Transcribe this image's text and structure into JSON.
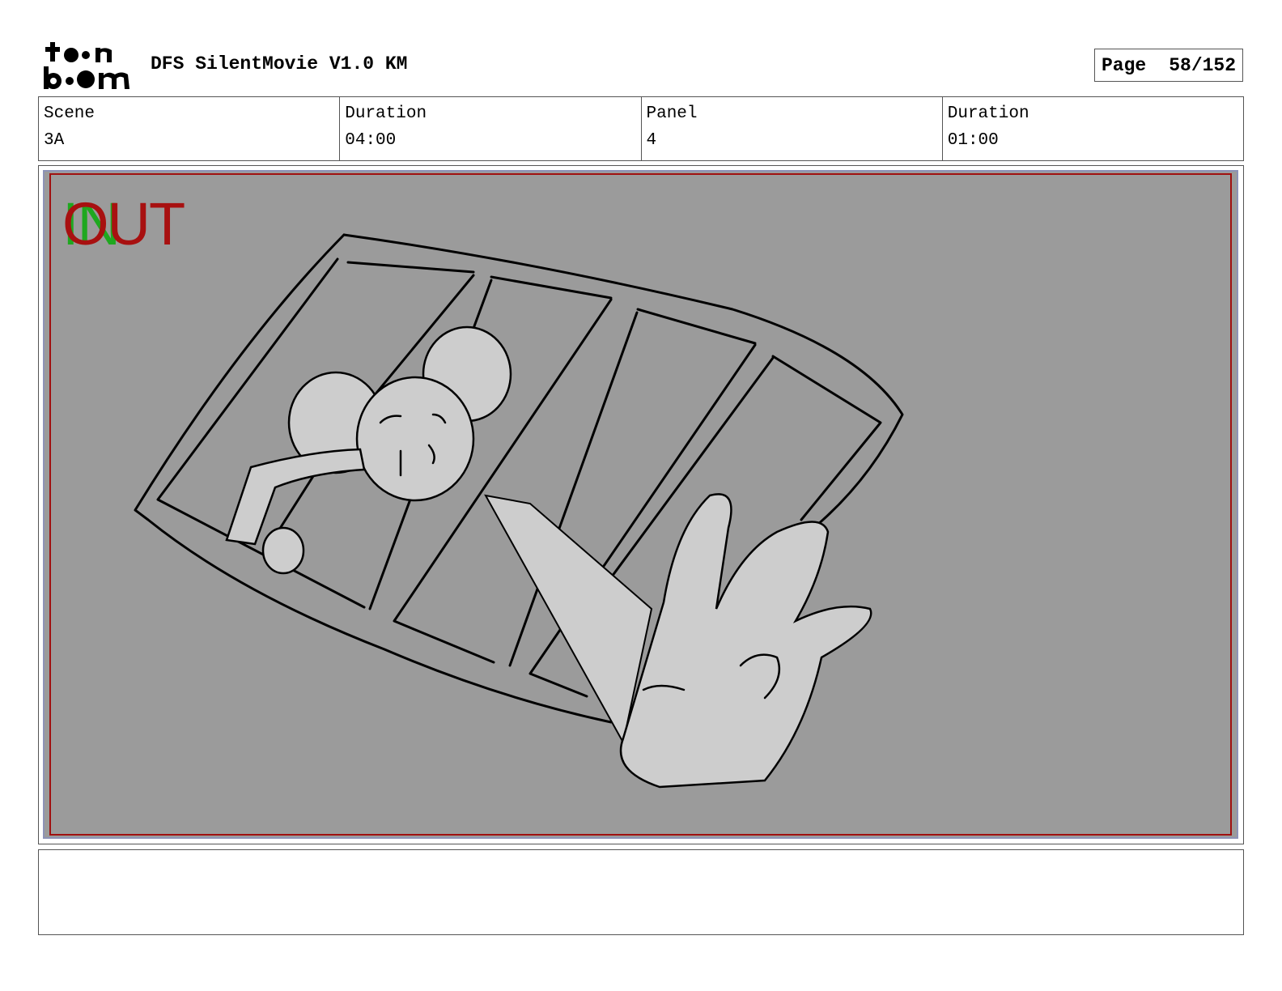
{
  "header": {
    "logo_text": "toon boom",
    "title": "DFS SilentMovie V1.0 KM",
    "page_label": "Page",
    "page_number": "58/152"
  },
  "info": {
    "scene_label": "Scene",
    "scene_value": "3A",
    "scene_duration_label": "Duration",
    "scene_duration_value": "04:00",
    "panel_label": "Panel",
    "panel_value": "4",
    "panel_duration_label": "Duration",
    "panel_duration_value": "01:00"
  },
  "panel": {
    "marker_in": "IN",
    "marker_out": "OUT"
  },
  "notes": {
    "text": ""
  }
}
